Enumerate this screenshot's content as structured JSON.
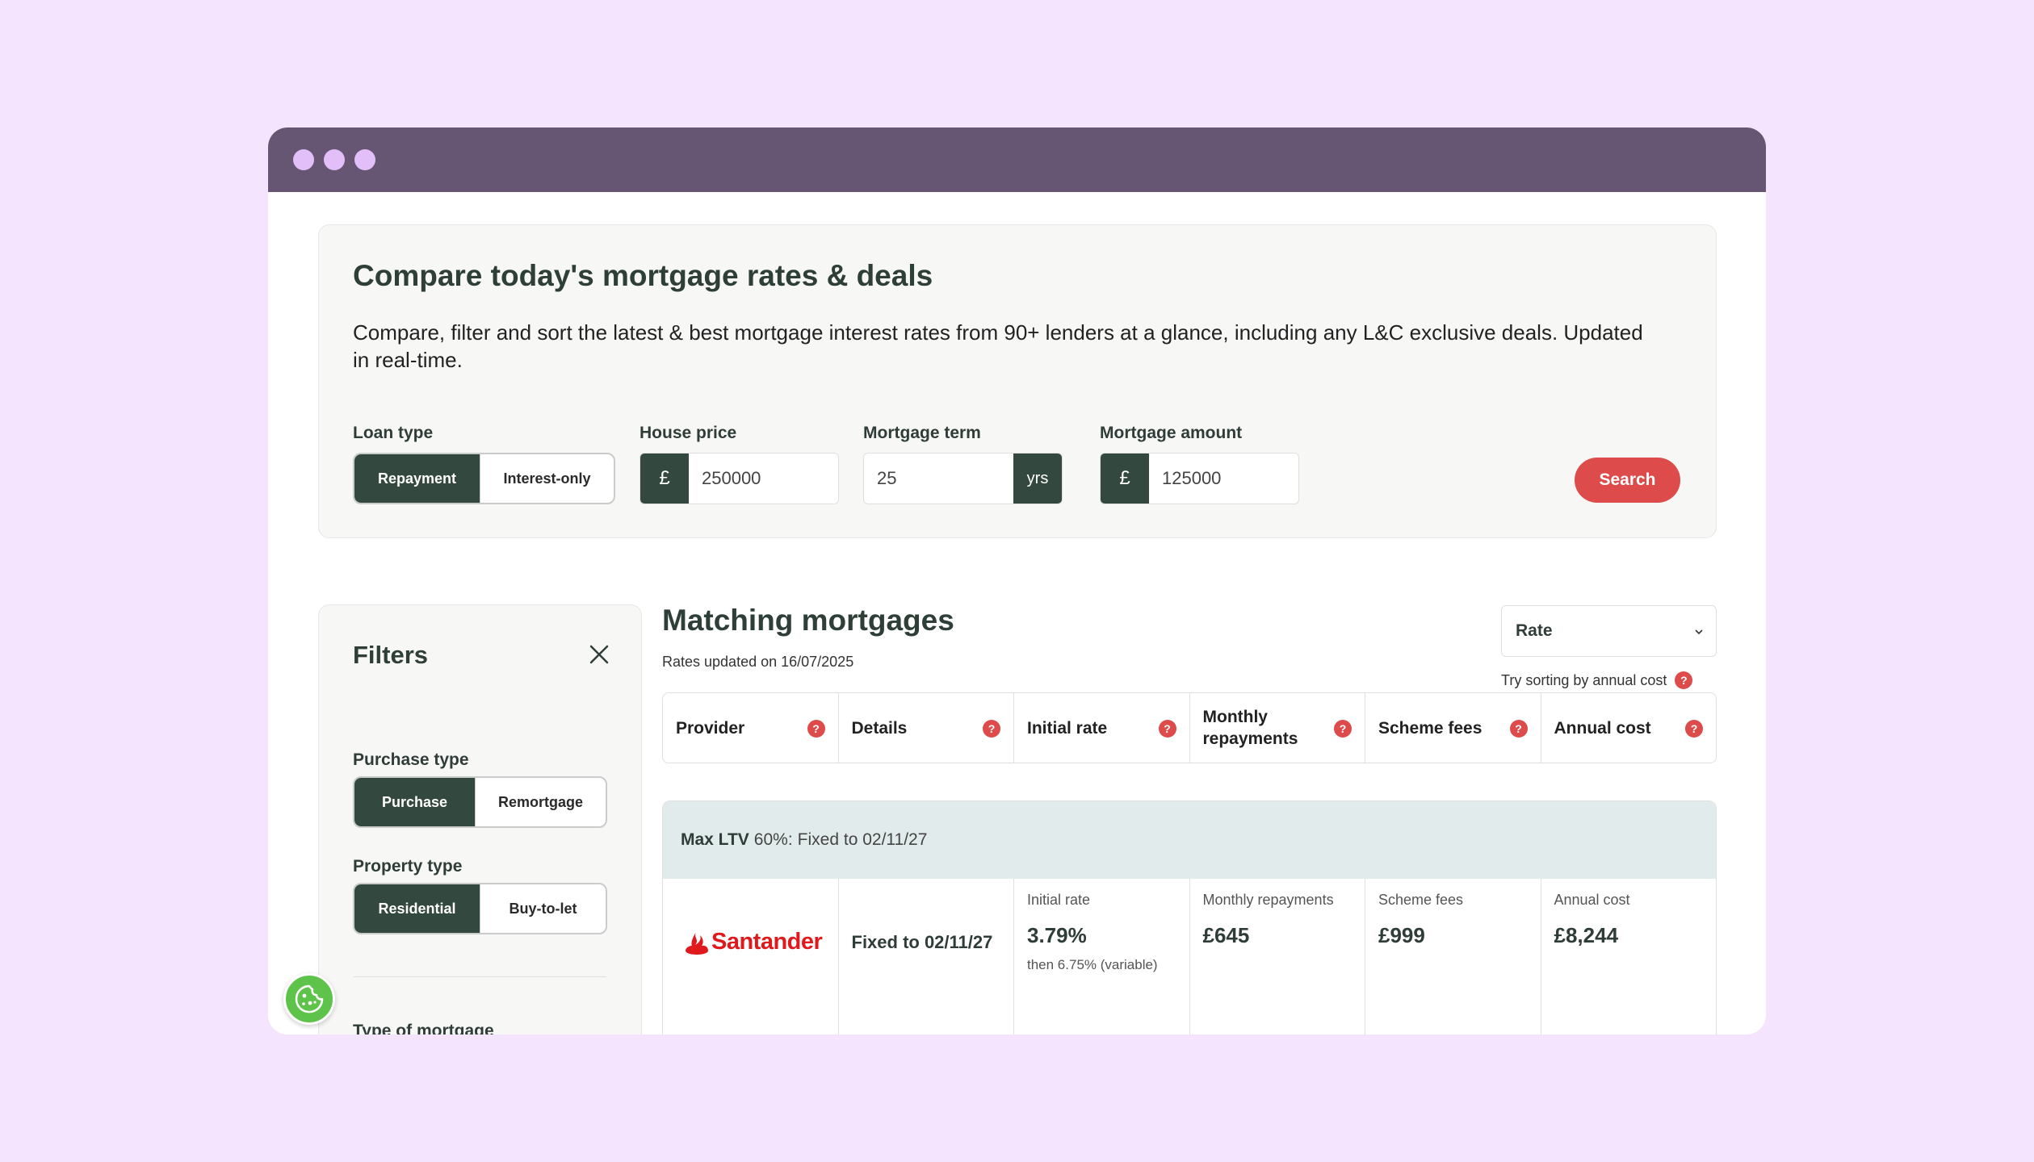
{
  "hero": {
    "title": "Compare today's mortgage rates & deals",
    "description": "Compare, filter and sort the latest & best mortgage interest rates from 90+ lenders at a glance, including any L&C exclusive deals. Updated in real-time.",
    "loan_type": {
      "label": "Loan type",
      "options": [
        "Repayment",
        "Interest-only"
      ],
      "selected": "Repayment"
    },
    "house_price": {
      "label": "House price",
      "prefix": "£",
      "value": "250000"
    },
    "mortgage_term": {
      "label": "Mortgage term",
      "value": "25",
      "suffix": "yrs"
    },
    "mortgage_amount": {
      "label": "Mortgage amount",
      "prefix": "£",
      "value": "125000"
    },
    "search_label": "Search"
  },
  "filters": {
    "title": "Filters",
    "purchase_type": {
      "label": "Purchase type",
      "options": [
        "Purchase",
        "Remortgage"
      ],
      "selected": "Purchase"
    },
    "property_type": {
      "label": "Property type",
      "options": [
        "Residential",
        "Buy-to-let"
      ],
      "selected": "Residential"
    },
    "type_of_mortgage_label": "Type of mortgage"
  },
  "results": {
    "title": "Matching mortgages",
    "updated": "Rates updated on 16/07/2025",
    "sort": {
      "selected": "Rate",
      "hint": "Try sorting by annual cost"
    },
    "columns": [
      "Provider",
      "Details",
      "Initial rate",
      "Monthly repayments",
      "Scheme fees",
      "Annual cost"
    ],
    "deal": {
      "max_ltv_label": "Max LTV",
      "max_ltv_value": "60%:",
      "fixed_text": "Fixed to 02/11/27",
      "provider": "Santander",
      "details": "Fixed to 02/11/27",
      "initial_rate_label": "Initial rate",
      "initial_rate": "3.79%",
      "then_rate": "then 6.75% (variable)",
      "monthly_label": "Monthly repayments",
      "monthly": "£645",
      "fees_label": "Scheme fees",
      "fees": "£999",
      "annual_label": "Annual cost",
      "annual": "£8,244"
    }
  },
  "colors": {
    "background": "#f4e4fe",
    "titlebar": "#665674",
    "dark_green": "#33493f",
    "accent_red": "#dd4b4b",
    "cookie_green": "#5ec34a",
    "santander_red": "#e0191c"
  }
}
